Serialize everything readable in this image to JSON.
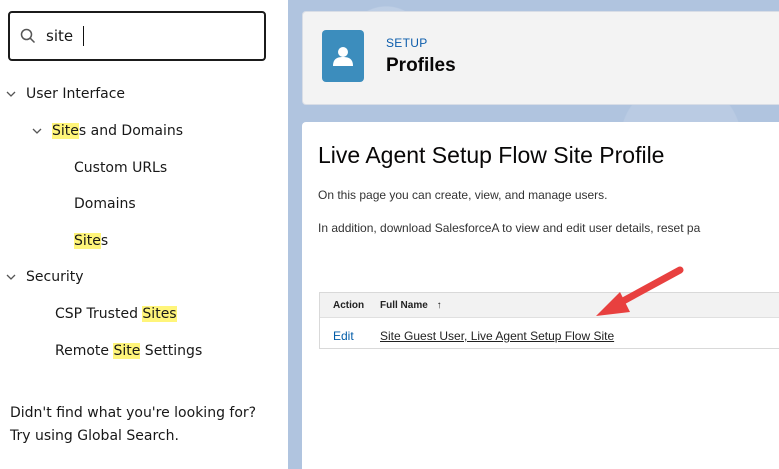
{
  "sidebar": {
    "search": {
      "value": "site"
    },
    "tree": [
      {
        "label_parts": [
          {
            "text": "User Interface",
            "hl": false
          }
        ]
      },
      {
        "label_parts": [
          {
            "text": "Site",
            "hl": true
          },
          {
            "text": "s and Domains",
            "hl": false
          }
        ]
      },
      {
        "label_parts": [
          {
            "text": "Custom URLs",
            "hl": false
          }
        ]
      },
      {
        "label_parts": [
          {
            "text": "Domains",
            "hl": false
          }
        ]
      },
      {
        "label_parts": [
          {
            "text": "Site",
            "hl": true
          },
          {
            "text": "s",
            "hl": false
          }
        ]
      },
      {
        "label_parts": [
          {
            "text": "Security",
            "hl": false
          }
        ]
      },
      {
        "label_parts": [
          {
            "text": "CSP Trusted ",
            "hl": false
          },
          {
            "text": "Sites",
            "hl": true
          }
        ]
      },
      {
        "label_parts": [
          {
            "text": "Remote ",
            "hl": false
          },
          {
            "text": "Site",
            "hl": true
          },
          {
            "text": " Settings",
            "hl": false
          }
        ]
      }
    ],
    "no_results_line1": "Didn't find what you're looking for?",
    "no_results_line2": "Try using Global Search."
  },
  "header": {
    "eyebrow": "SETUP",
    "title": "Profiles",
    "icon": "user-icon"
  },
  "content": {
    "title": "Live Agent Setup Flow Site Profile",
    "desc1": "On this page you can create, view, and manage users.",
    "desc2": "In addition, download SalesforceA to view and edit user details, reset pa",
    "table": {
      "col_action": "Action",
      "col_fullname": "Full Name",
      "sort_indicator": "↑",
      "rows": [
        {
          "action": "Edit",
          "full_name": "Site Guest User, Live Agent Setup Flow Site"
        }
      ]
    }
  },
  "colors": {
    "highlight": "#fff57a",
    "accent_blue": "#0b5cab",
    "header_icon_bg": "#3c8dbd",
    "arrow_red": "#e8403f"
  }
}
